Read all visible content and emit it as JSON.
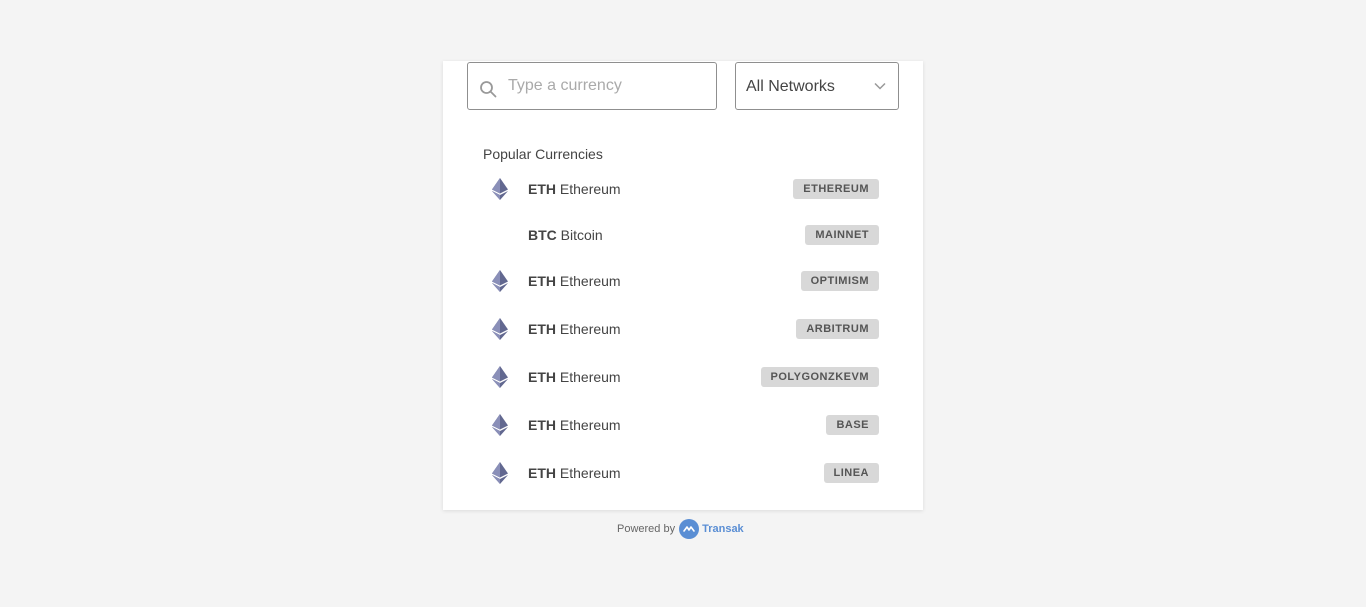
{
  "search": {
    "placeholder": "Type a currency",
    "value": ""
  },
  "network_filter": {
    "selected": "All Networks"
  },
  "section_title": "Popular Currencies",
  "currencies": [
    {
      "symbol": "ETH",
      "name": "Ethereum",
      "network": "ETHEREUM",
      "icon": "ethereum-icon"
    },
    {
      "symbol": "BTC",
      "name": "Bitcoin",
      "network": "MAINNET",
      "icon": "none"
    },
    {
      "symbol": "ETH",
      "name": "Ethereum",
      "network": "OPTIMISM",
      "icon": "ethereum-icon"
    },
    {
      "symbol": "ETH",
      "name": "Ethereum",
      "network": "ARBITRUM",
      "icon": "ethereum-icon"
    },
    {
      "symbol": "ETH",
      "name": "Ethereum",
      "network": "POLYGONZKEVM",
      "icon": "ethereum-icon"
    },
    {
      "symbol": "ETH",
      "name": "Ethereum",
      "network": "BASE",
      "icon": "ethereum-icon"
    },
    {
      "symbol": "ETH",
      "name": "Ethereum",
      "network": "LINEA",
      "icon": "ethereum-icon"
    }
  ],
  "footer": {
    "powered_by": "Powered by",
    "brand": "Transak"
  },
  "colors": {
    "background": "#f4f4f4",
    "card": "#ffffff",
    "badge": "#d8d8d8",
    "ethereum_icon": "#626890",
    "brand": "#5a8ed4"
  }
}
